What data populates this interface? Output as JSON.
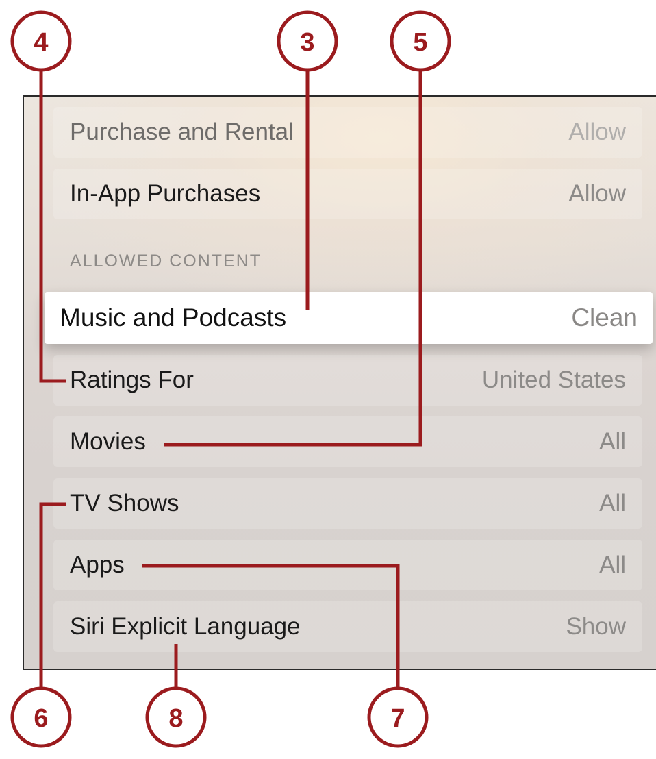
{
  "settings": {
    "section_header": "ALLOWED CONTENT",
    "rows": [
      {
        "label": "Purchase and Rental",
        "value": "Allow"
      },
      {
        "label": "In-App Purchases",
        "value": "Allow"
      },
      {
        "label": "Music and Podcasts",
        "value": "Clean"
      },
      {
        "label": "Ratings For",
        "value": "United States"
      },
      {
        "label": "Movies",
        "value": "All"
      },
      {
        "label": "TV Shows",
        "value": "All"
      },
      {
        "label": "Apps",
        "value": "All"
      },
      {
        "label": "Siri Explicit Language",
        "value": "Show"
      }
    ]
  },
  "callouts": {
    "c3": "3",
    "c4": "4",
    "c5": "5",
    "c6": "6",
    "c7": "7",
    "c8": "8"
  },
  "colors": {
    "callout": "#9b1b1e",
    "focused_row": "#ffffff",
    "panel_border": "#2a2a2a"
  }
}
